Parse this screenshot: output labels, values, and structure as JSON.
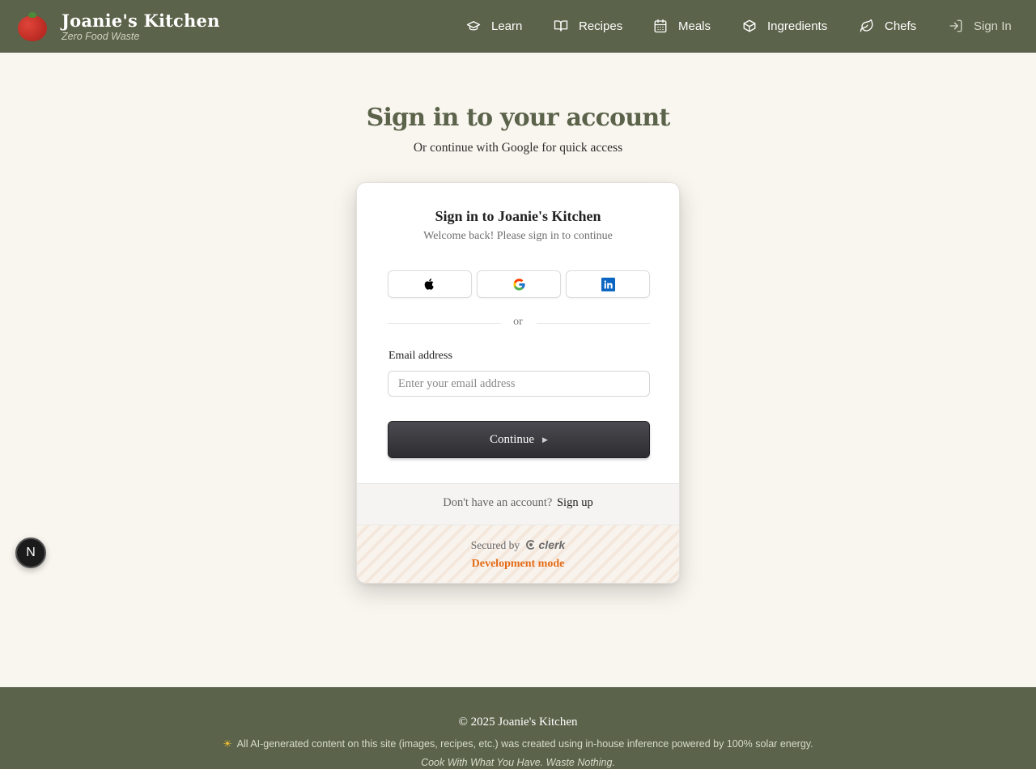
{
  "brand": {
    "name": "Joanie's Kitchen",
    "tagline": "Zero Food Waste"
  },
  "nav": {
    "learn": "Learn",
    "recipes": "Recipes",
    "meals": "Meals",
    "ingredients": "Ingredients",
    "chefs": "Chefs",
    "sign_in": "Sign In"
  },
  "hero": {
    "title": "Sign in to your account",
    "subtitle": "Or continue with Google for quick access"
  },
  "card": {
    "title": "Sign in to Joanie's Kitchen",
    "subtitle": "Welcome back! Please sign in to continue",
    "social": [
      "apple-icon",
      "google-icon",
      "linkedin-icon"
    ],
    "divider_text": "or",
    "email_label": "Email address",
    "email_placeholder": "Enter your email address",
    "email_value": "",
    "continue_label": "Continue",
    "no_account_text": "Don't have an account?",
    "sign_up_link": "Sign up",
    "secured_by": "Secured by",
    "secured_brand": "clerk",
    "dev_mode": "Development mode"
  },
  "dev_badge": {
    "letter": "N"
  },
  "footer": {
    "copyright": "© 2025 Joanie's Kitchen",
    "solar_note": "All AI-generated content on this site (images, recipes, etc.) was created using in-house inference powered by 100% solar energy.",
    "tagline": "Cook With What You Have. Waste Nothing."
  },
  "colors": {
    "header_bg": "#5b634a",
    "page_bg": "#f9f5ef",
    "title_color": "#5b634a",
    "button_dark": "#2d2d32",
    "dev_mode_orange": "#e36b16"
  }
}
